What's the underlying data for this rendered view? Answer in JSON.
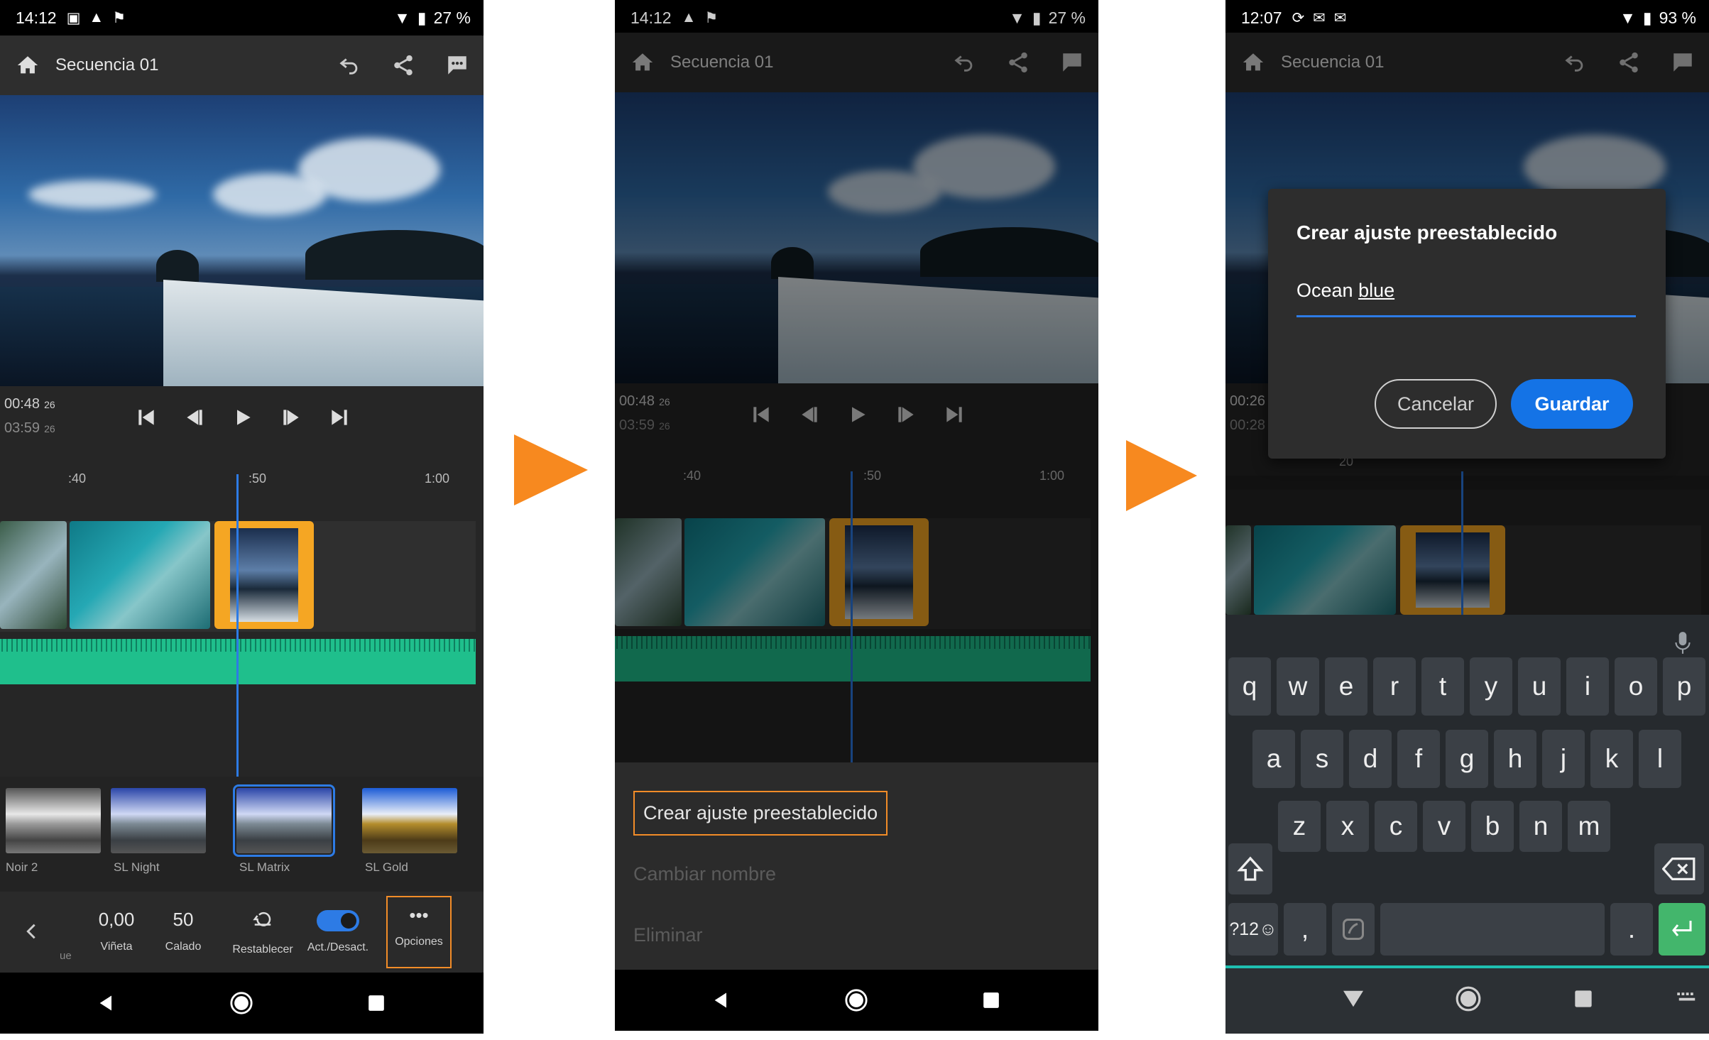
{
  "status_bar": {
    "screen1": {
      "time": "14:12",
      "battery": "27 %"
    },
    "screen2": {
      "time": "14:12",
      "battery": "27 %"
    },
    "screen3": {
      "time": "12:07",
      "battery": "93 %"
    }
  },
  "appbar": {
    "title": "Secuencia 01"
  },
  "transport": {
    "screen1": {
      "current_time": "00:48",
      "current_frame": "26",
      "total_time": "03:59",
      "total_frame": "26"
    },
    "screen2": {
      "current_time": "00:48",
      "current_frame": "26",
      "total_time": "03:59",
      "total_frame": "26"
    },
    "screen3": {
      "current_time": "00:26",
      "total_time": "00:28"
    }
  },
  "ruler": {
    "ticks": [
      ":40",
      ":50",
      "1:00"
    ],
    "screen3_tick": "20"
  },
  "presets": [
    {
      "label": "Noir 2"
    },
    {
      "label": "SL Night"
    },
    {
      "label": "SL Matrix",
      "selected": true
    },
    {
      "label": "SL Gold"
    }
  ],
  "tools": {
    "partial_label": "ue",
    "vignette": {
      "value": "0,00",
      "label": "Viñeta"
    },
    "feather": {
      "value": "50",
      "label": "Calado"
    },
    "reset": {
      "label": "Restablecer"
    },
    "toggle": {
      "label": "Act./Desact.",
      "on": true
    },
    "options": {
      "icon": "•••",
      "label": "Opciones"
    }
  },
  "preset_menu": {
    "create": "Crear ajuste preestablecido",
    "rename": "Cambiar nombre",
    "delete": "Eliminar"
  },
  "dialog": {
    "title": "Crear ajuste preestablecido",
    "input_word1": "Ocean",
    "input_word2": "blue",
    "cancel": "Cancelar",
    "save": "Guardar"
  },
  "keyboard": {
    "row1": [
      "q",
      "w",
      "e",
      "r",
      "t",
      "y",
      "u",
      "i",
      "o",
      "p"
    ],
    "row2": [
      "a",
      "s",
      "d",
      "f",
      "g",
      "h",
      "j",
      "k",
      "l"
    ],
    "row3": [
      "z",
      "x",
      "c",
      "v",
      "b",
      "n",
      "m"
    ],
    "symbols": "?12☺",
    "comma": ",",
    "period": "."
  },
  "colors": {
    "accent": "#2d7be5",
    "highlight": "#f5a623",
    "arrow": "#f7891f",
    "save": "#1473e6",
    "audio": "#1fbf8c"
  }
}
